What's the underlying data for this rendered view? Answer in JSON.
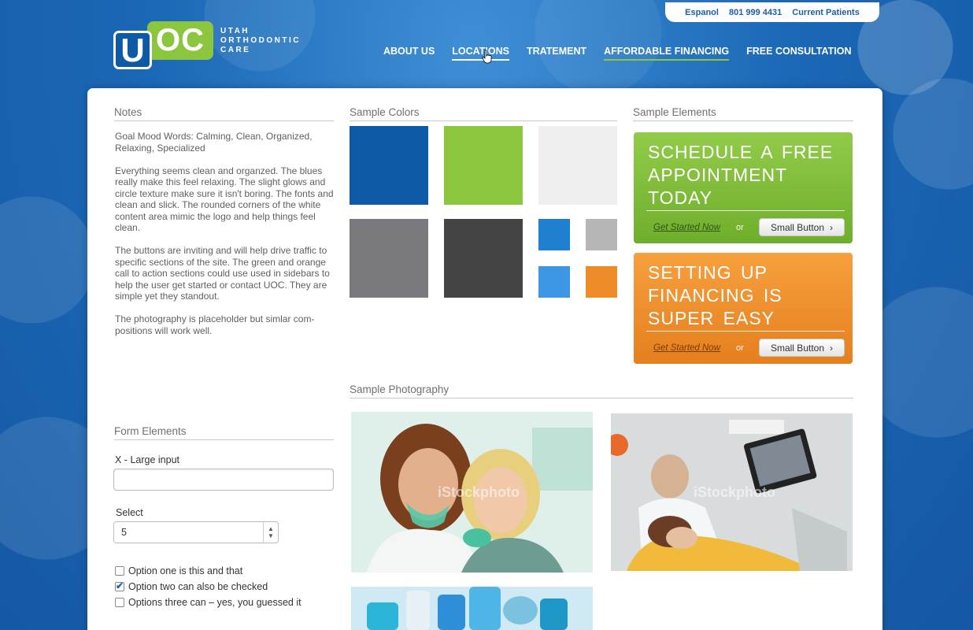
{
  "utility_bar": {
    "links": [
      "Espanol",
      "801 999 4431",
      "Current Patients"
    ]
  },
  "logo": {
    "u": "U",
    "oc": "OC",
    "text_lines": [
      "UTAH",
      "ORTHODONTIC",
      "CARE"
    ]
  },
  "nav": {
    "items": [
      "ABOUT US",
      "LOCATIONS",
      "TRATEMENT",
      "AFFORDABLE FINANCING",
      "FREE CONSULTATION"
    ]
  },
  "notes": {
    "title": "Notes",
    "paragraphs": [
      "Goal Mood Words: Calming, Clean, Organized, Relaxing, Specialized",
      "Everything seems clean and organzed. The blues really make this feel relaxing. The slight glows and circle texture make sure it isn't boring. The fonts and clean and slick. The rounded corners of the white content area mimic the logo and help things feel clean.",
      "The buttons are inviting and will help drive traffic to specific sections of the site. The green and orange call to action sections could use used in sidebars to help the user get started or contact UOC. They are simple yet they standout.",
      "The photography is placeholder but simlar com-positions will work well."
    ]
  },
  "sample_colors": {
    "title": "Sample Colors",
    "swatches": [
      "#0f5aa6",
      "#8cc63f",
      "#efefef",
      "#7a7a7e",
      "#444444",
      "#1f7fd0",
      "#b6b6b6",
      "#3d97e4",
      "#ee8c2a"
    ]
  },
  "sample_elements": {
    "title": "Sample Elements",
    "cta_green": {
      "title": "SCHEDULE A FREE APPOINTMENT TODAY",
      "link": "Get Started Now",
      "or": "or",
      "button": "Small Button",
      "button_arrow": "›"
    },
    "cta_orange": {
      "title": "SETTING UP FINANCING IS SUPER EASY",
      "link": "Get Started Now",
      "or": "or",
      "button": "Small Button",
      "button_arrow": "›"
    }
  },
  "sample_photography": {
    "title": "Sample Photography",
    "watermark": "iStockphoto"
  },
  "form_elements": {
    "title": "Form Elements",
    "large_input_label": "X - Large input",
    "select_label": "Select",
    "select_value": "5",
    "checkboxes": [
      {
        "label": "Option one is this and that",
        "checked": false
      },
      {
        "label": "Option two can also be checked",
        "checked": true
      },
      {
        "label": "Options three can – yes, you guessed it",
        "checked": false
      }
    ]
  }
}
